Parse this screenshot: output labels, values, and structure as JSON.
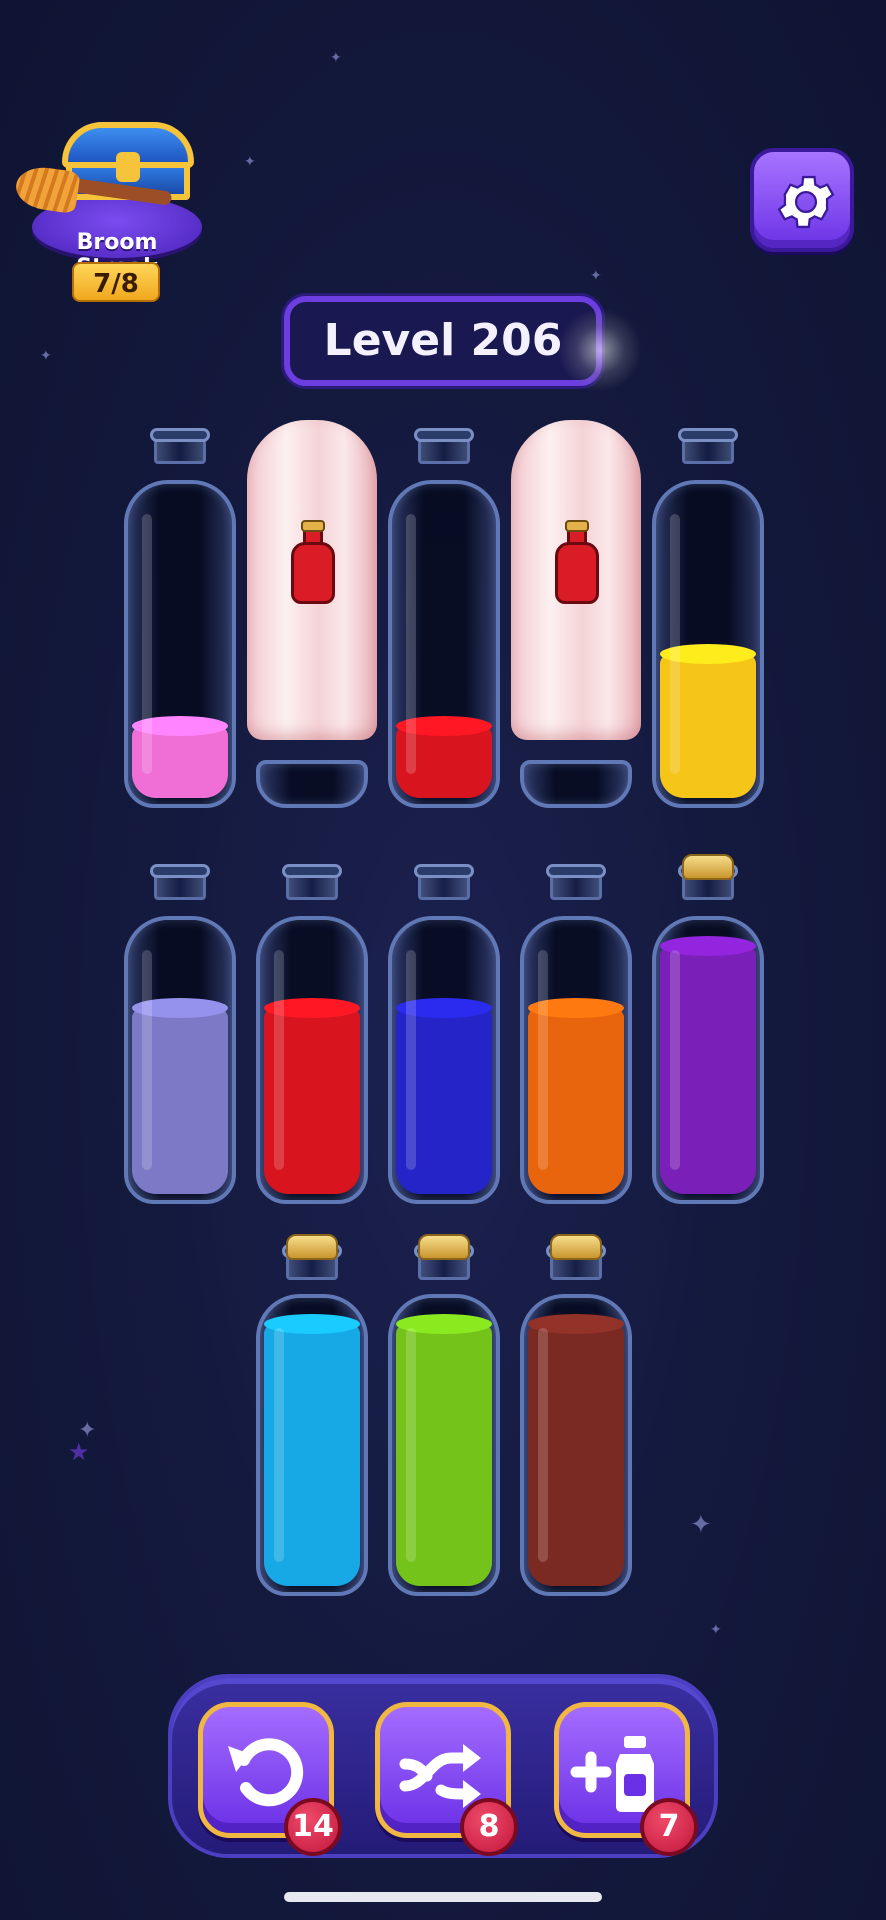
{
  "streak": {
    "label": "Broom Streak",
    "count": "7/8"
  },
  "level": {
    "label": "Level 206"
  },
  "settings": {
    "icon": "gear-icon"
  },
  "bottles_row1": [
    {
      "type": "glass",
      "fill": 0.25,
      "color": "#ef6fd6"
    },
    {
      "type": "hidden",
      "icon": "bottle-icon"
    },
    {
      "type": "glass",
      "fill": 0.25,
      "color": "#d8141e"
    },
    {
      "type": "hidden",
      "icon": "bottle-icon"
    },
    {
      "type": "glass",
      "fill": 0.5,
      "color": "#f5c518"
    }
  ],
  "bottles_row2": [
    {
      "type": "glass",
      "fill": 0.75,
      "color": "#7c7ac6"
    },
    {
      "type": "glass",
      "fill": 0.75,
      "color": "#d8141e"
    },
    {
      "type": "glass",
      "fill": 0.75,
      "color": "#2424c8"
    },
    {
      "type": "glass",
      "fill": 0.75,
      "color": "#e8650e"
    },
    {
      "type": "glass",
      "fill": 1.0,
      "color": "#7a1fb8",
      "corked": true
    }
  ],
  "bottles_row3": [
    {
      "type": "glass",
      "fill": 1.0,
      "color": "#16a9e6",
      "corked": true
    },
    {
      "type": "glass",
      "fill": 1.0,
      "color": "#74c31a",
      "corked": true
    },
    {
      "type": "glass",
      "fill": 1.0,
      "color": "#7a2a22",
      "corked": true
    }
  ],
  "powerups": [
    {
      "name": "undo",
      "icon": "undo-icon",
      "count": "14"
    },
    {
      "name": "shuffle",
      "icon": "shuffle-icon",
      "count": "8"
    },
    {
      "name": "add-bottle",
      "icon": "add-bottle-icon",
      "count": "7"
    }
  ]
}
